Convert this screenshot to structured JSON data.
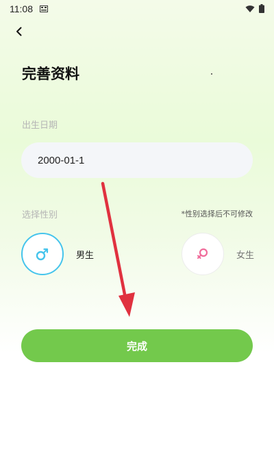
{
  "status_bar": {
    "time": "11:08"
  },
  "header": {
    "title": "完善资料"
  },
  "birth": {
    "label": "出生日期",
    "value": "2000-01-1"
  },
  "gender": {
    "label": "选择性别",
    "note": "*性别选择后不可修改",
    "options": [
      {
        "label": "男生",
        "selected": true,
        "color": "#45c4ec"
      },
      {
        "label": "女生",
        "selected": false,
        "color": "#f06b9a"
      }
    ]
  },
  "actions": {
    "complete_label": "完成"
  },
  "colors": {
    "accent": "#73c94c",
    "annotation_arrow": "#e0313f"
  }
}
